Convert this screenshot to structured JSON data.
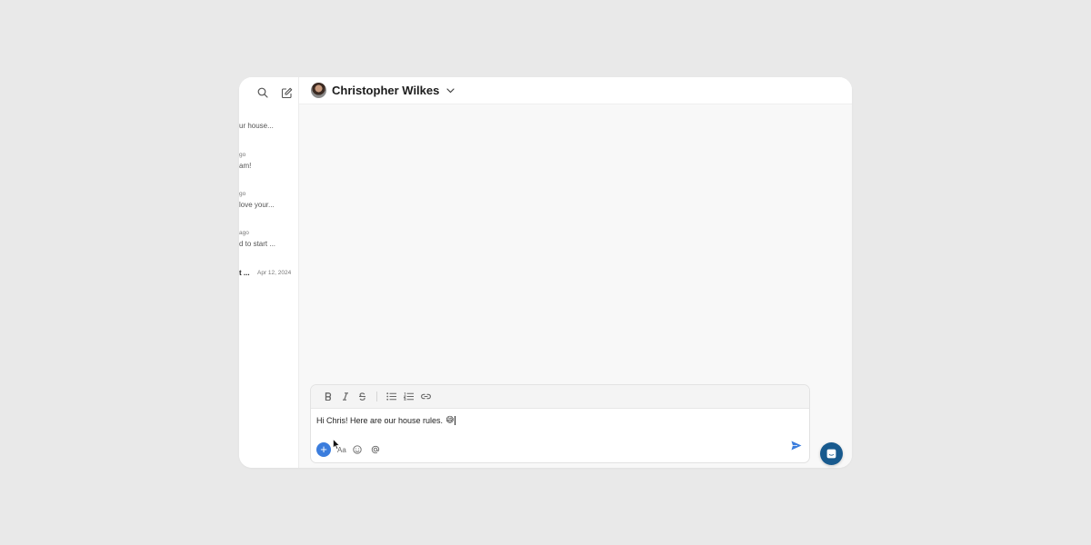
{
  "sidebar": {
    "conversations": [
      {
        "meta": "",
        "preview": "ur house..."
      },
      {
        "meta": "go",
        "preview": "am!"
      },
      {
        "meta": "go",
        "preview": "love your..."
      },
      {
        "meta": "ago",
        "preview": "d to start ..."
      }
    ],
    "last_conversation": {
      "name": "t ...",
      "date": "Apr 12, 2024"
    }
  },
  "header": {
    "contact_name": "Christopher Wilkes"
  },
  "composer": {
    "message_text": "Hi Chris! Here are our house rules.",
    "emoji": "😅",
    "format_label": "Aa"
  },
  "icons": [
    "search-icon",
    "compose-icon",
    "chevron-down-icon",
    "bold-icon",
    "italic-icon",
    "strikethrough-icon",
    "bullet-list-icon",
    "numbered-list-icon",
    "link-icon",
    "plus-icon",
    "emoji-icon",
    "mention-icon",
    "send-icon",
    "chat-icon"
  ],
  "colors": {
    "accent": "#3b7ddd",
    "launcher": "#185a8e",
    "send": "#3b7ddd"
  }
}
